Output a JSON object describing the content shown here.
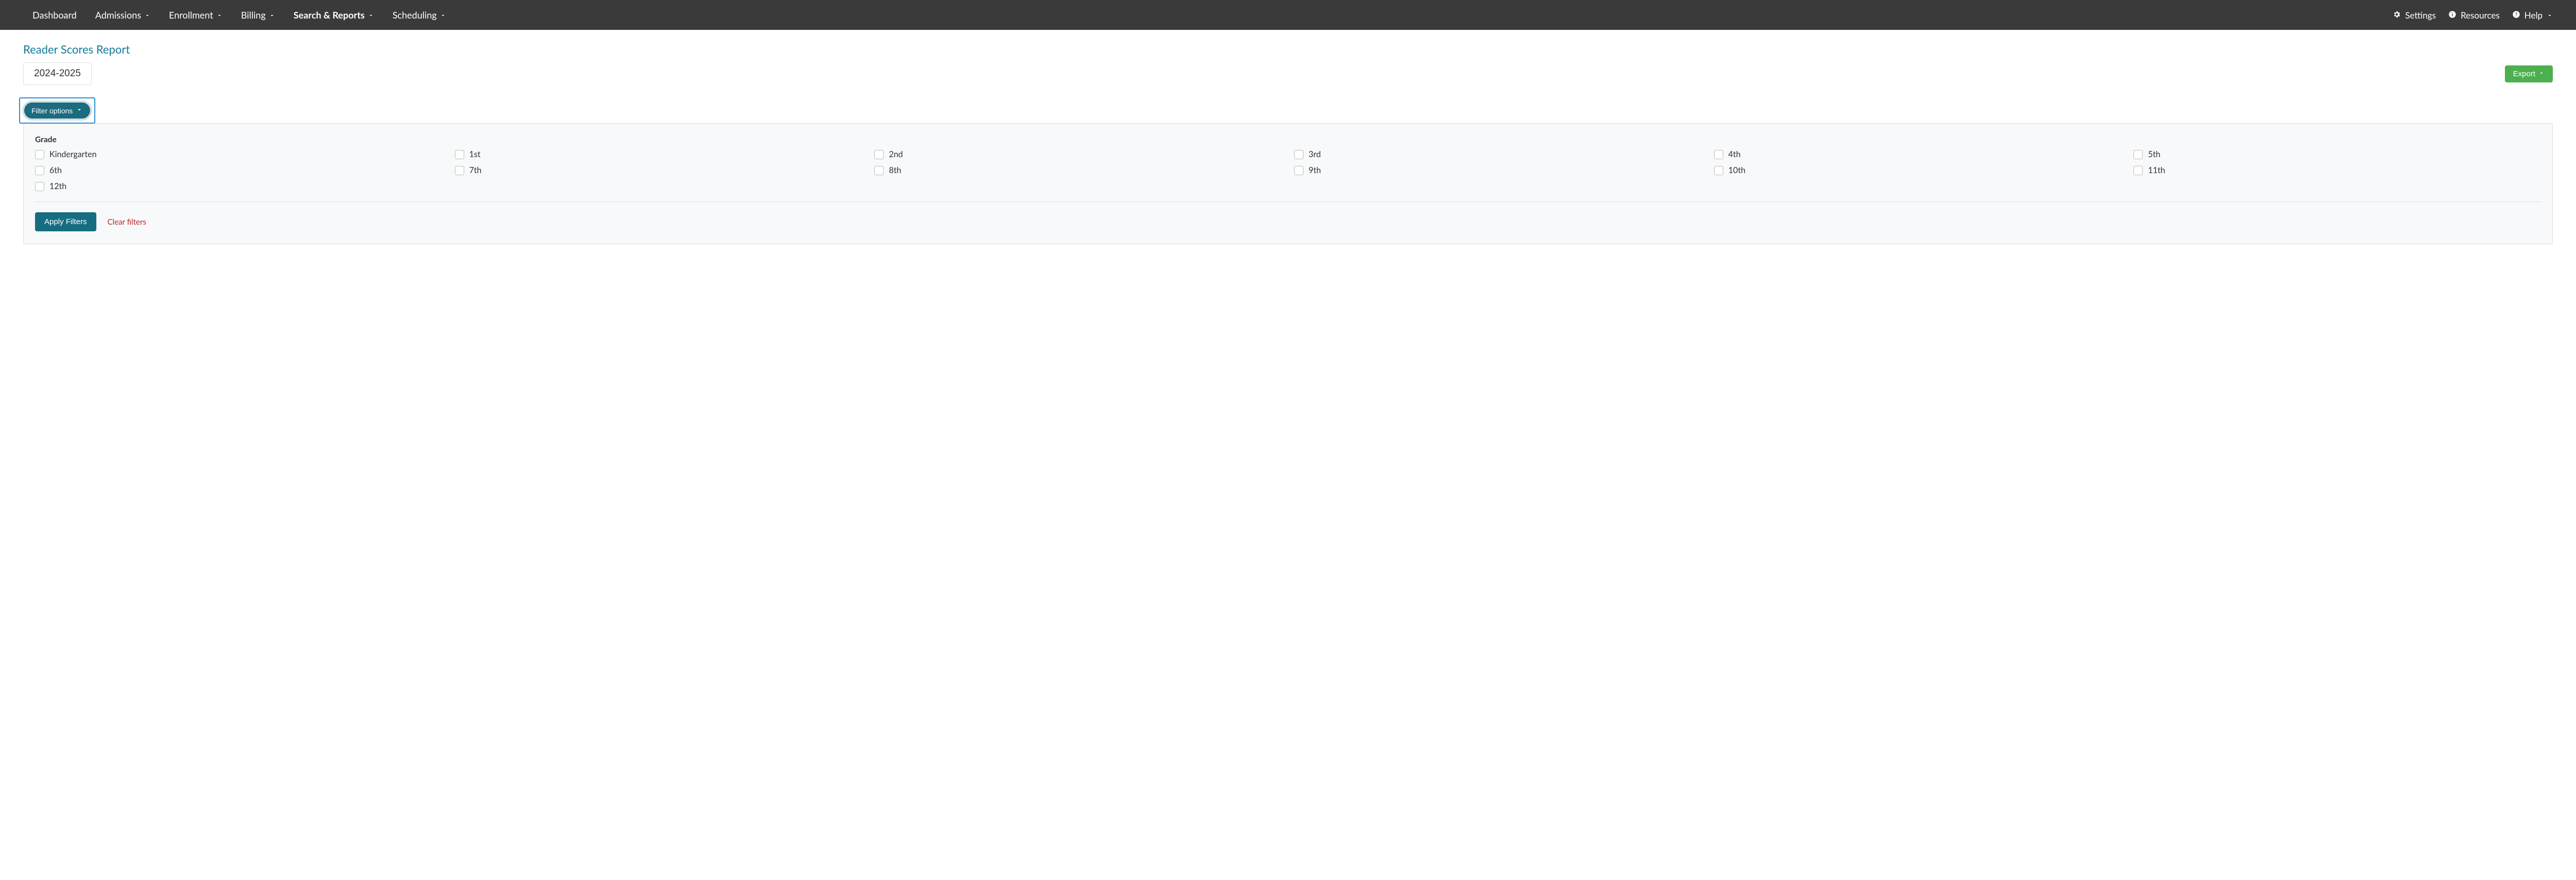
{
  "nav": {
    "left": [
      {
        "label": "Dashboard",
        "dropdown": false,
        "active": false
      },
      {
        "label": "Admissions",
        "dropdown": true,
        "active": false
      },
      {
        "label": "Enrollment",
        "dropdown": true,
        "active": false
      },
      {
        "label": "Billing",
        "dropdown": true,
        "active": false
      },
      {
        "label": "Search & Reports",
        "dropdown": true,
        "active": true
      },
      {
        "label": "Scheduling",
        "dropdown": true,
        "active": false
      }
    ],
    "right": [
      {
        "icon": "gear",
        "label": "Settings",
        "dropdown": false
      },
      {
        "icon": "info",
        "label": "Resources",
        "dropdown": false
      },
      {
        "icon": "help",
        "label": "Help",
        "dropdown": true
      }
    ]
  },
  "page": {
    "title": "Reader Scores Report",
    "year": "2024-2025",
    "export_label": "Export"
  },
  "filter": {
    "toggle_label": "Filter options",
    "section_label": "Grade",
    "grades": [
      "Kindergarten",
      "1st",
      "2nd",
      "3rd",
      "4th",
      "5th",
      "6th",
      "7th",
      "8th",
      "9th",
      "10th",
      "11th",
      "12th"
    ],
    "apply_label": "Apply Filters",
    "clear_label": "Clear filters"
  }
}
